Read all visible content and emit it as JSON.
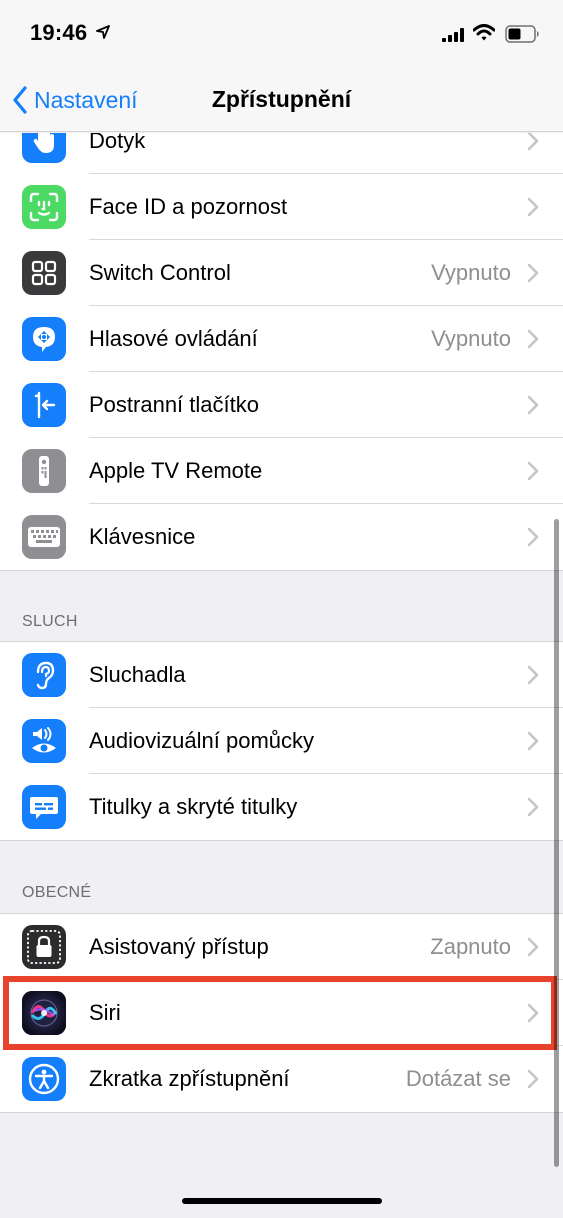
{
  "status_bar": {
    "time": "19:46"
  },
  "nav": {
    "back_label": "Nastavení",
    "title": "Zpřístupnění"
  },
  "groups": {
    "motor": [
      {
        "label": "Dotyk",
        "value": "",
        "icon": "touch-hand-icon",
        "color": "#147efb"
      },
      {
        "label": "Face ID a pozornost",
        "value": "",
        "icon": "face-id-icon",
        "color": "#4cd964"
      },
      {
        "label": "Switch Control",
        "value": "Vypnuto",
        "icon": "switch-control-icon",
        "color": "#3a3a3c"
      },
      {
        "label": "Hlasové ovládání",
        "value": "Vypnuto",
        "icon": "voice-control-icon",
        "color": "#147efb"
      },
      {
        "label": "Postranní tlačítko",
        "value": "",
        "icon": "side-button-icon",
        "color": "#147efb"
      },
      {
        "label": "Apple TV Remote",
        "value": "",
        "icon": "tv-remote-icon",
        "color": "#8e8e93"
      },
      {
        "label": "Klávesnice",
        "value": "",
        "icon": "keyboard-icon",
        "color": "#8e8e93"
      }
    ],
    "hearing_header": "SLUCH",
    "hearing": [
      {
        "label": "Sluchadla",
        "value": "",
        "icon": "ear-icon",
        "color": "#147efb"
      },
      {
        "label": "Audiovizuální pomůcky",
        "value": "",
        "icon": "audio-visual-icon",
        "color": "#147efb"
      },
      {
        "label": "Titulky a skryté titulky",
        "value": "",
        "icon": "subtitles-icon",
        "color": "#147efb"
      }
    ],
    "general_header": "OBECNÉ",
    "general": [
      {
        "label": "Asistovaný přístup",
        "value": "Zapnuto",
        "icon": "guided-access-lock-icon",
        "color": "#2c2c2e"
      },
      {
        "label": "Siri",
        "value": "",
        "icon": "siri-icon",
        "color": "#1c1c3a"
      },
      {
        "label": "Zkratka zpřístupnění",
        "value": "Dotázat se",
        "icon": "accessibility-shortcut-icon",
        "color": "#147efb"
      }
    ]
  },
  "highlight_color": "#e8412c",
  "accent_color": "#147efb"
}
